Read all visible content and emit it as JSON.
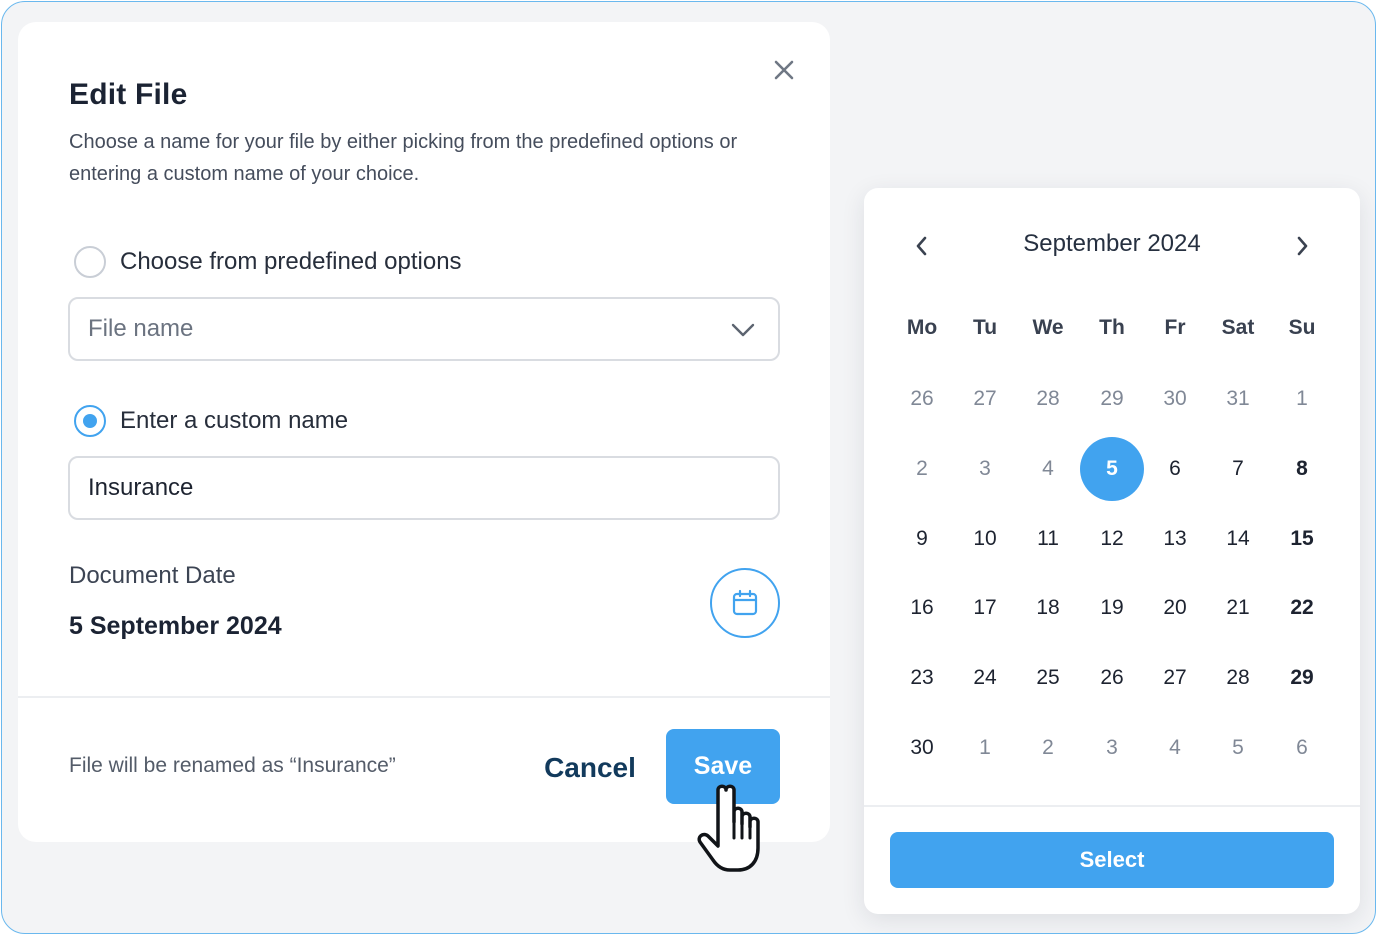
{
  "dialog": {
    "title": "Edit File",
    "description": "Choose a name for your file by either picking from the predefined options or entering a custom name of your choice.",
    "option_predefined": {
      "label": "Choose from predefined options",
      "selected": false
    },
    "file_name_select": {
      "value": "File name",
      "icon": "chevron-down-icon"
    },
    "option_custom": {
      "label": "Enter a custom name",
      "selected": true
    },
    "custom_name_input": {
      "value": "Insurance"
    },
    "document_date_label": "Document Date",
    "document_date_value": "5 September 2024",
    "calendar_button_icon": "calendar-icon",
    "close_icon": "close-icon",
    "rename_note": "File will be renamed as “Insurance”",
    "cancel_label": "Cancel",
    "save_label": "Save"
  },
  "cursor": {
    "icon": "hand-pointer-icon"
  },
  "calendar": {
    "month_label": "September 2024",
    "prev_icon": "chevron-left-icon",
    "next_icon": "chevron-right-icon",
    "weekdays": [
      "Mo",
      "Tu",
      "We",
      "Th",
      "Fr",
      "Sat",
      "Su"
    ],
    "weeks": [
      [
        "26",
        "27",
        "28",
        "29",
        "30",
        "31",
        "1"
      ],
      [
        "2",
        "3",
        "4",
        "5",
        "6",
        "7",
        "8"
      ],
      [
        "9",
        "10",
        "11",
        "12",
        "13",
        "14",
        "15"
      ],
      [
        "16",
        "17",
        "18",
        "19",
        "20",
        "21",
        "22"
      ],
      [
        "23",
        "24",
        "25",
        "26",
        "27",
        "28",
        "29"
      ],
      [
        "30",
        "1",
        "2",
        "3",
        "4",
        "5",
        "6"
      ]
    ],
    "outside_month": [
      [
        true,
        true,
        true,
        true,
        true,
        true,
        true
      ],
      [
        true,
        true,
        true,
        false,
        false,
        false,
        false
      ],
      [
        false,
        false,
        false,
        false,
        false,
        false,
        false
      ],
      [
        false,
        false,
        false,
        false,
        false,
        false,
        false
      ],
      [
        false,
        false,
        false,
        false,
        false,
        false,
        false
      ],
      [
        false,
        true,
        true,
        true,
        true,
        true,
        true
      ]
    ],
    "selected_day": "5",
    "select_label": "Select",
    "accent_color": "#41a3ef"
  }
}
